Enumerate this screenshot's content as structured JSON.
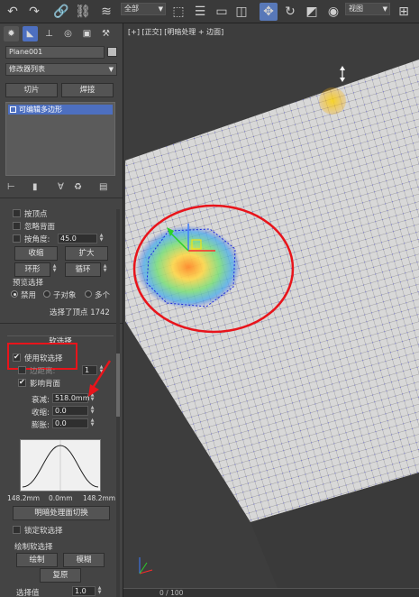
{
  "toolbar": {
    "selection_filter": "全部",
    "reference_coord": "视图"
  },
  "panel": {
    "object_name": "Plane001",
    "modifier_list": "修改器列表",
    "slice_button": "切片",
    "weld_button": "焊接",
    "stack_item": "可编辑多边形",
    "selection": {
      "by_vertex": "按顶点",
      "ignore_backfacing": "忽略背面",
      "by_angle": "按角度:",
      "angle_value": "45.0",
      "shrink": "收缩",
      "grow": "扩大",
      "ring": "环形",
      "loop": "循环",
      "preview_selection": "预览选择",
      "disabled": "禁用",
      "subobject": "子对象",
      "multi": "多个",
      "status": "选择了顶点 1742"
    },
    "soft_selection": {
      "header": "软选择",
      "use_soft_selection": "使用软选择",
      "edge_distance": "边距离:",
      "edge_distance_value": "1",
      "affect_backfacing": "影响背面",
      "falloff_label": "衰减:",
      "falloff_value": "518.0mm",
      "pinch_label": "收缩:",
      "pinch_value": "0.0",
      "bubble_label": "膨胀:",
      "bubble_value": "0.0",
      "curve_left": "148.2mm",
      "curve_mid": "0.0mm",
      "curve_right": "148.2mm",
      "shaded_face_toggle": "明暗处理面切换",
      "lock_soft_selection": "锁定软选择",
      "paint_group": "绘制软选择",
      "paint": "绘制",
      "blur": "模糊",
      "revert": "复原",
      "selection_value_label": "选择值",
      "selection_value": "1.0"
    }
  },
  "viewport": {
    "label": "[+] [正交] [明暗处理 + 边面]",
    "timeline": "0 / 100"
  },
  "colors": {
    "annotation_red": "#e8141b",
    "selection_blue": "#4d6fc0"
  }
}
